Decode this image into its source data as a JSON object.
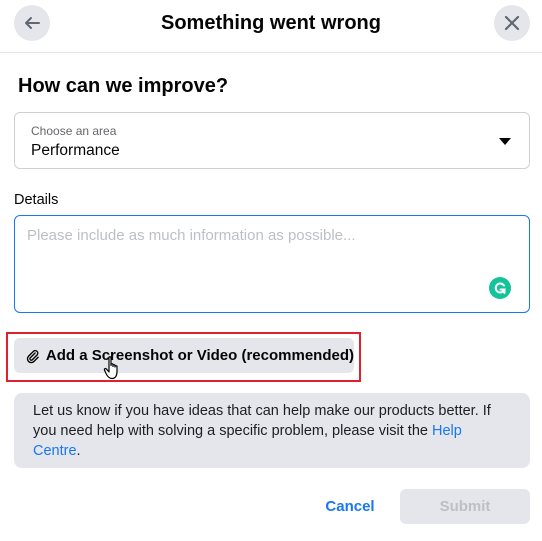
{
  "header": {
    "title": "Something went wrong",
    "back_icon": "arrow-left-icon",
    "close_icon": "close-icon"
  },
  "form": {
    "heading": "How can we improve?",
    "area_select": {
      "label": "Choose an area",
      "value": "Performance",
      "caret_icon": "caret-down-icon"
    },
    "details": {
      "label": "Details",
      "placeholder": "Please include as much information as possible...",
      "value": "",
      "grammarly_icon": "grammarly-icon"
    },
    "attach": {
      "label": "Add a Screenshot or Video (recommended)",
      "icon": "paperclip-icon"
    },
    "info": {
      "text": "Let us know if you have ideas that can help make our products better. If you need help with solving a specific problem, please visit the ",
      "link": "Help Centre",
      "suffix": "."
    }
  },
  "footer": {
    "cancel_label": "Cancel",
    "submit_label": "Submit"
  },
  "colors": {
    "accent": "#1877f2",
    "highlight": "#e0202e",
    "grammarly": "#15c39a"
  }
}
